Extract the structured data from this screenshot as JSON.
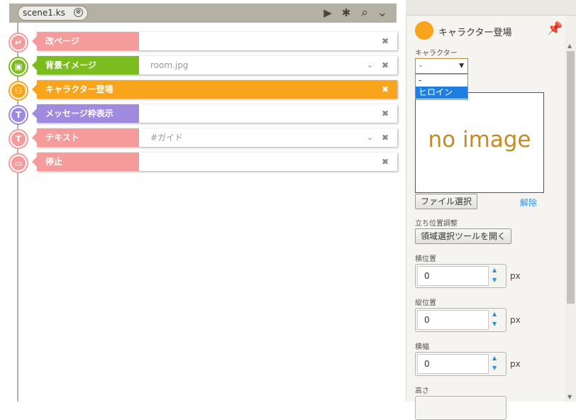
{
  "editor": {
    "scene_tab": "scene1.ks",
    "scene_close": "⊗",
    "tools": {
      "play": "▶",
      "bug": "✱",
      "search": "⌕",
      "collapse": "⌄"
    },
    "rows": [
      {
        "label": "改ページ",
        "value": "",
        "color": "#f59b9b",
        "icon": "page-break-icon",
        "glyph": "↵",
        "chevron": "",
        "close": "✖"
      },
      {
        "label": "背景イメージ",
        "value": "room.jpg",
        "color": "#7bbd1e",
        "icon": "image-icon",
        "glyph": "▣",
        "chevron": "⌄",
        "close": "✖"
      },
      {
        "label": "キャラクター登場",
        "value": "",
        "color": "#f9a51b",
        "icon": "character-enter-icon",
        "glyph": "⚇",
        "chevron": "",
        "close": "✖"
      },
      {
        "label": "メッセージ枠表示",
        "value": "",
        "color": "#a08ae0",
        "icon": "message-window-icon",
        "glyph": "T",
        "chevron": "",
        "close": "✖"
      },
      {
        "label": "テキスト",
        "value": "#ガイド",
        "color": "#f59b9b",
        "icon": "text-icon",
        "glyph": "T",
        "chevron": "⌄",
        "close": "✖"
      },
      {
        "label": "停止",
        "value": "",
        "color": "#f59b9b",
        "icon": "stop-icon",
        "glyph": "▭",
        "chevron": "",
        "close": "✖"
      }
    ]
  },
  "panel": {
    "title": "キャラクター登場",
    "pin": "📌",
    "character_label": "キャラクター",
    "character_selected": "-",
    "character_arrow": "▼",
    "options": [
      "-",
      "ヒロイン"
    ],
    "no_image": "no image",
    "file_button": "ファイル選択",
    "clear_link": "解除",
    "position_label": "立ち位置調整",
    "region_button": "領域選択ツールを開く",
    "x_label": "横位置",
    "x_value": "0",
    "y_label": "縦位置",
    "y_value": "0",
    "w_label": "横幅",
    "w_value": "0",
    "h_label": "高さ",
    "unit": "px",
    "spin_up": "▲",
    "spin_down": "▼"
  }
}
